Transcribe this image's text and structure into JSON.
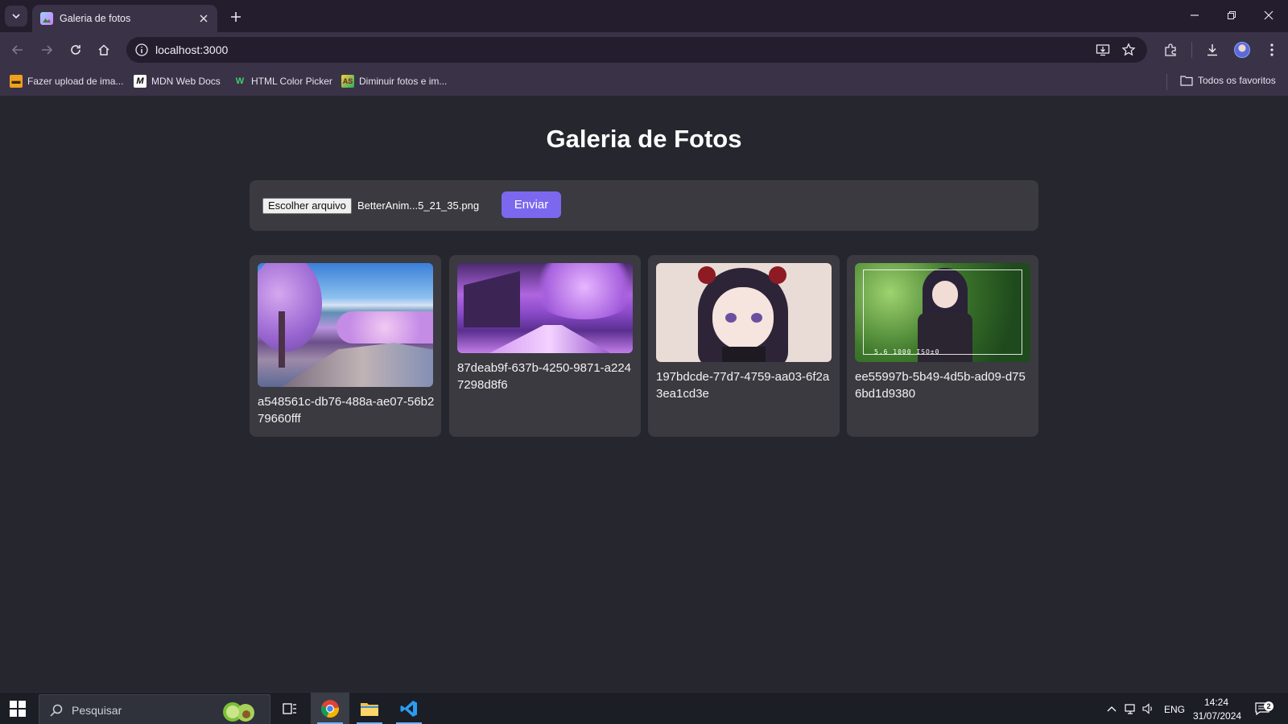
{
  "browser": {
    "tab_title": "Galeria de fotos",
    "url": "localhost:3000",
    "bookmarks": [
      {
        "label": "Fazer upload de ima...",
        "icon": "imgbb-icon"
      },
      {
        "label": "MDN Web Docs",
        "icon": "mdn-icon"
      },
      {
        "label": "HTML Color Picker",
        "icon": "w3schools-icon"
      },
      {
        "label": "Diminuir fotos e im...",
        "icon": "resize-icon"
      }
    ],
    "all_bookmarks_label": "Todos os favoritos"
  },
  "page": {
    "title": "Galeria de Fotos",
    "upload": {
      "choose_file_label": "Escolher arquivo",
      "selected_file": "BetterAnim...5_21_35.png",
      "submit_label": "Enviar"
    },
    "photos": [
      {
        "name": "a548561c-db76-488a-ae07-56b279660fff"
      },
      {
        "name": "87deab9f-637b-4250-9871-a2247298d8f6"
      },
      {
        "name": "197bdcde-77d7-4759-aa03-6f2a3ea1cd3e"
      },
      {
        "name": "ee55997b-5b49-4d5b-ad09-d756bd1d9380"
      }
    ],
    "photo4_overlay": "5.6  1000  ISO±0"
  },
  "taskbar": {
    "search_placeholder": "Pesquisar",
    "language": "ENG",
    "time": "14:24",
    "date": "31/07/2024",
    "notification_count": "2"
  },
  "colors": {
    "page_bg": "#26262e",
    "panel_bg": "#3a3a40",
    "accent_button": "#7b68ee",
    "chrome_bg": "#3a3347"
  }
}
